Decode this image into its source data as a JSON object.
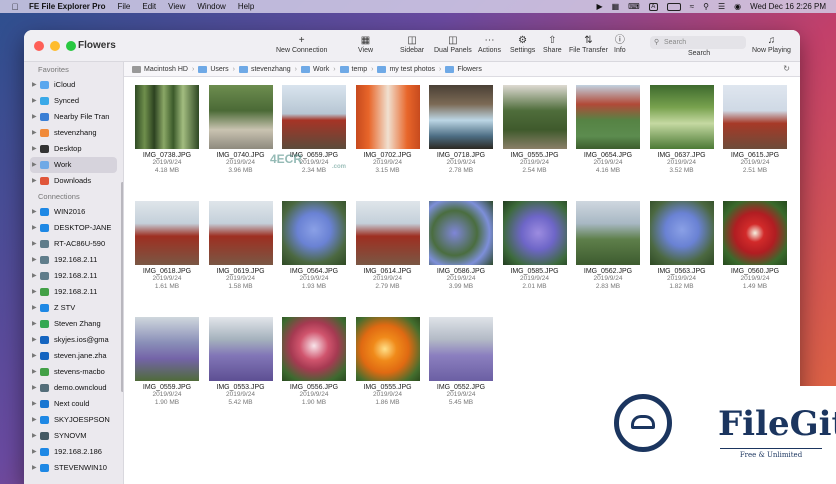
{
  "menubar": {
    "app": "FE File Explorer Pro",
    "menus": [
      "File",
      "Edit",
      "View",
      "Window",
      "Help"
    ],
    "input_indicator": "A",
    "datetime": "Wed Dec 16  2:26 PM"
  },
  "window": {
    "title": "Flowers",
    "toolbar": {
      "new_connection": "New Connection",
      "view": "View",
      "sidebar": "Sidebar",
      "dual_panels": "Dual Panels",
      "actions": "Actions",
      "settings": "Settings",
      "share": "Share",
      "file_transfer": "File Transfer",
      "info": "Info",
      "search_placeholder": "Search",
      "search_label": "Search",
      "now_playing": "Now Playing"
    }
  },
  "sidebar": {
    "favorites_header": "Favorites",
    "favorites": [
      {
        "label": "iCloud",
        "color": "#5aa7ee"
      },
      {
        "label": "Synced",
        "color": "#3aa9e8"
      },
      {
        "label": "Nearby File Tran",
        "color": "#3a7fd5"
      },
      {
        "label": "stevenzhang",
        "color": "#f08a3a"
      },
      {
        "label": "Desktop",
        "color": "#333333"
      },
      {
        "label": "Work",
        "color": "#6fa9e6"
      },
      {
        "label": "Downloads",
        "color": "#e0563a"
      }
    ],
    "connections_header": "Connections",
    "connections": [
      {
        "label": "WIN2016",
        "color": "#1e88e5"
      },
      {
        "label": "DESKTOP-JANE",
        "color": "#1e88e5"
      },
      {
        "label": "RT-AC86U-590",
        "color": "#607d8b"
      },
      {
        "label": "192.168.2.11",
        "color": "#607d8b"
      },
      {
        "label": "192.168.2.11",
        "color": "#607d8b"
      },
      {
        "label": "192.168.2.11",
        "color": "#43a047"
      },
      {
        "label": "Z STV",
        "color": "#1e88e5"
      },
      {
        "label": "Steven Zhang",
        "color": "#34a853"
      },
      {
        "label": "skyjes.ios@gma",
        "color": "#1565c0"
      },
      {
        "label": "steven.jane.zha",
        "color": "#1565c0"
      },
      {
        "label": "stevens-macbo",
        "color": "#43a047"
      },
      {
        "label": "demo.owncloud",
        "color": "#546e7a"
      },
      {
        "label": "Next could",
        "color": "#1976d2"
      },
      {
        "label": "SKYJOESPSON",
        "color": "#1e88e5"
      },
      {
        "label": "SYNOVM",
        "color": "#455a64"
      },
      {
        "label": "192.168.2.186",
        "color": "#1e88e5"
      },
      {
        "label": "STEVENWIN10",
        "color": "#1e88e5"
      }
    ]
  },
  "pathbar": [
    "Macintosh HD",
    "Users",
    "stevenzhang",
    "Work",
    "temp",
    "my test photos",
    "Flowers"
  ],
  "files": [
    {
      "name": "IMG_0738.JPG",
      "date": "2019/9/24",
      "size": "4.18 MB",
      "style": "bamboo"
    },
    {
      "name": "IMG_0740.JPG",
      "date": "2019/9/24",
      "size": "3.96 MB",
      "style": "path"
    },
    {
      "name": "IMG_0659.JPG",
      "date": "2019/9/24",
      "size": "2.34 MB",
      "style": "shrine"
    },
    {
      "name": "IMG_0702.JPG",
      "date": "2019/9/24",
      "size": "3.15 MB",
      "style": "torii"
    },
    {
      "name": "IMG_0718.JPG",
      "date": "2019/9/24",
      "size": "2.78 MB",
      "style": "bridge"
    },
    {
      "name": "IMG_0555.JPG",
      "date": "2019/9/24",
      "size": "2.54 MB",
      "style": "garden"
    },
    {
      "name": "IMG_0654.JPG",
      "date": "2019/9/24",
      "size": "4.16 MB",
      "style": "pond"
    },
    {
      "name": "IMG_0637.JPG",
      "date": "2019/9/24",
      "size": "3.52 MB",
      "style": "lotus"
    },
    {
      "name": "IMG_0615.JPG",
      "date": "2019/9/24",
      "size": "2.51 MB",
      "style": "pagoda"
    },
    {
      "name": "IMG_0618.JPG",
      "date": "2019/9/24",
      "size": "1.61 MB",
      "style": "pagoda2"
    },
    {
      "name": "IMG_0619.JPG",
      "date": "2019/9/24",
      "size": "1.58 MB",
      "style": "pagoda2"
    },
    {
      "name": "IMG_0564.JPG",
      "date": "2019/9/24",
      "size": "1.93 MB",
      "style": "hydr"
    },
    {
      "name": "IMG_0614.JPG",
      "date": "2019/9/24",
      "size": "2.79 MB",
      "style": "pagoda2"
    },
    {
      "name": "IMG_0586.JPG",
      "date": "2019/9/24",
      "size": "3.99 MB",
      "style": "hydr2"
    },
    {
      "name": "IMG_0585.JPG",
      "date": "2019/9/24",
      "size": "2.01 MB",
      "style": "hydr3"
    },
    {
      "name": "IMG_0562.JPG",
      "date": "2019/9/24",
      "size": "2.83 MB",
      "style": "hill"
    },
    {
      "name": "IMG_0563.JPG",
      "date": "2019/9/24",
      "size": "1.82 MB",
      "style": "hydr"
    },
    {
      "name": "IMG_0560.JPG",
      "date": "2019/9/24",
      "size": "1.49 MB",
      "style": "redflower"
    },
    {
      "name": "IMG_0559.JPG",
      "date": "2019/9/24",
      "size": "1.90 MB",
      "style": "lav"
    },
    {
      "name": "IMG_0553.JPG",
      "date": "2019/9/24",
      "size": "5.42 MB",
      "style": "lav2"
    },
    {
      "name": "IMG_0556.JPG",
      "date": "2019/9/24",
      "size": "1.90 MB",
      "style": "zinnia"
    },
    {
      "name": "IMG_0555.JPG",
      "date": "2019/9/24",
      "size": "1.86 MB",
      "style": "zinnia2"
    },
    {
      "name": "IMG_0552.JPG",
      "date": "2019/9/24",
      "size": "5.45 MB",
      "style": "lav3"
    }
  ],
  "watermarks": {
    "ecr": "4ECR",
    "ecr_sub": ".com",
    "filegit_name": "FileGit",
    "filegit_tag": "Free & Unlimited"
  }
}
